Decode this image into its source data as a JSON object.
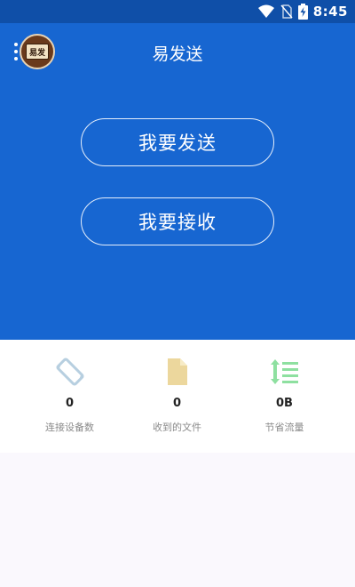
{
  "status_bar": {
    "time": "8:45",
    "icons": [
      "wifi-icon",
      "no-sim-icon",
      "battery-charging-icon"
    ]
  },
  "header": {
    "title": "易发送",
    "logo_text": "易发",
    "menu_icon": "more-vertical-icon"
  },
  "actions": {
    "send_label": "我要发送",
    "receive_label": "我要接收"
  },
  "stats": [
    {
      "icon": "screen-rotation-icon",
      "value": "0",
      "label": "连接设备数"
    },
    {
      "icon": "file-icon",
      "value": "0",
      "label": "收到的文件"
    },
    {
      "icon": "sort-lines-icon",
      "value": "0B",
      "label": "节省流量"
    }
  ],
  "colors": {
    "primary": "#1766d1",
    "status_bar": "#0f4fa8",
    "rotation_icon": "#b7cfe0",
    "file_icon": "#ecd79d",
    "traffic_icon": "#8ee0a0"
  }
}
